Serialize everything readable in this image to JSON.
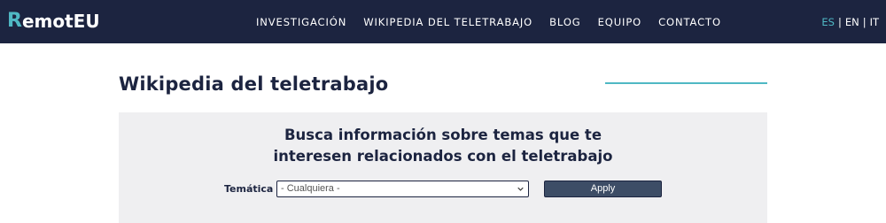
{
  "header": {
    "logo_mark": "R",
    "logo_text": "emotEU",
    "nav": [
      "INVESTIGACIÓN",
      "WIKIPEDIA DEL TELETRABAJO",
      "BLOG",
      "EQUIPO",
      "CONTACTO"
    ],
    "languages": [
      "ES",
      "EN",
      "IT"
    ],
    "active_language": "ES",
    "lang_separator": "|"
  },
  "main": {
    "title": "Wikipedia del teletrabajo",
    "search": {
      "heading_line1": "Busca información sobre temas que te",
      "heading_line2": "interesen relacionados con el teletrabajo",
      "filter_label": "Temática",
      "select_value": "- Cualquiera -",
      "apply_label": "Apply"
    }
  },
  "colors": {
    "header_bg": "#1c2440",
    "accent": "#4fb8c4",
    "panel_bg": "#efeff1",
    "button_bg": "#3d4d66"
  }
}
